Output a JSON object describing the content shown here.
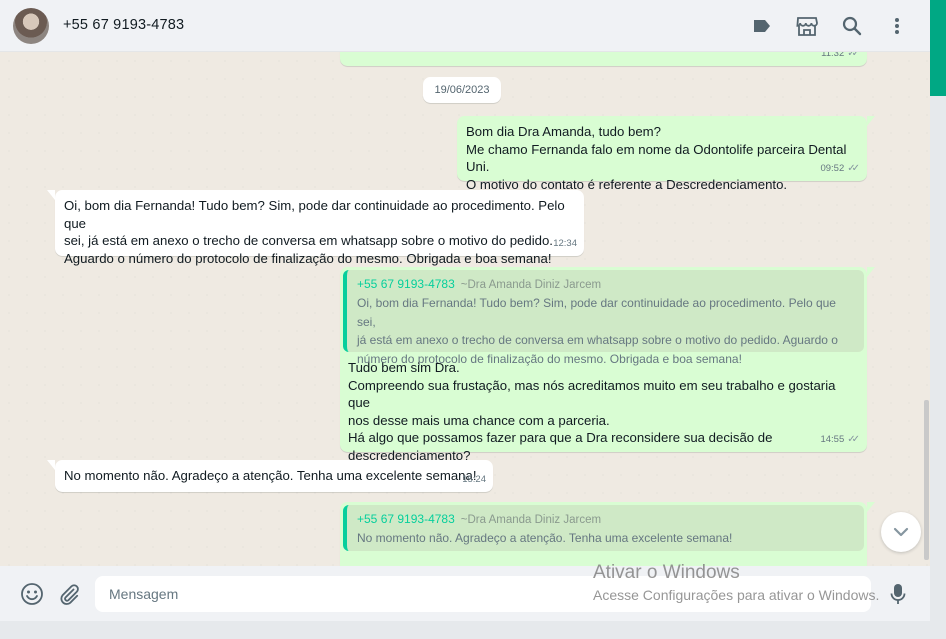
{
  "header": {
    "contact_name": "+55 67 9193-4783",
    "icons": [
      "label-icon",
      "catalog-icon",
      "search-icon",
      "menu-icon"
    ]
  },
  "chat": {
    "date_chip": "19/06/2023",
    "partial_top": {
      "time": "11:32"
    },
    "messages": [
      {
        "direction": "out",
        "text": "Bom dia Dra Amanda, tudo bem?\nMe chamo Fernanda falo em nome da Odontolife parceira Dental Uni.\nO motivo do contato é referente a Descredenciamento.",
        "time": "09:52"
      },
      {
        "direction": "in",
        "text": "Oi, bom dia Fernanda! Tudo bem? Sim, pode dar continuidade ao procedimento. Pelo que\nsei, já está em anexo o trecho de conversa em whatsapp sobre o motivo  do pedido.\nAguardo o número do protocolo de finalização do mesmo. Obrigada e boa semana!",
        "time": "12:34"
      },
      {
        "direction": "out",
        "quote": {
          "sender": "+55 67 9193-4783",
          "push_name": "~Dra Amanda Diniz Jarcem",
          "text": "Oi, bom dia Fernanda! Tudo bem? Sim, pode dar continuidade ao procedimento. Pelo que sei,\njá está em anexo o trecho de conversa em whatsapp sobre o motivo  do pedido. Aguardo o\nnúmero do protocolo de finalização do mesmo. Obrigada e boa semana!"
        },
        "text": "Tudo bem sim Dra.\nCompreendo sua frustação, mas nós acreditamos muito em seu trabalho e gostaria que\nnos desse mais uma chance com a parceria.\nHá algo que possamos fazer para que a Dra reconsidere sua decisão de\ndescredenciamento?",
        "time": "14:55"
      },
      {
        "direction": "in",
        "text": "No momento não. Agradeço a atenção. Tenha uma excelente semana!",
        "time": "15:24"
      },
      {
        "direction": "out",
        "quote": {
          "sender": "+55 67 9193-4783",
          "push_name": "~Dra Amanda Diniz Jarcem",
          "text": "No momento não. Agradeço a atenção. Tenha uma excelente semana!"
        },
        "text": ""
      }
    ]
  },
  "footer": {
    "input_placeholder": "Mensagem"
  },
  "watermark": {
    "line1": "Ativar o Windows",
    "line2": "Acesse Configurações para ativar o Windows."
  },
  "colors": {
    "outgoing_bubble": "#d9fdd3",
    "incoming_bubble": "#ffffff",
    "accent": "#00a884",
    "quote_sender": "#06cf9c"
  }
}
